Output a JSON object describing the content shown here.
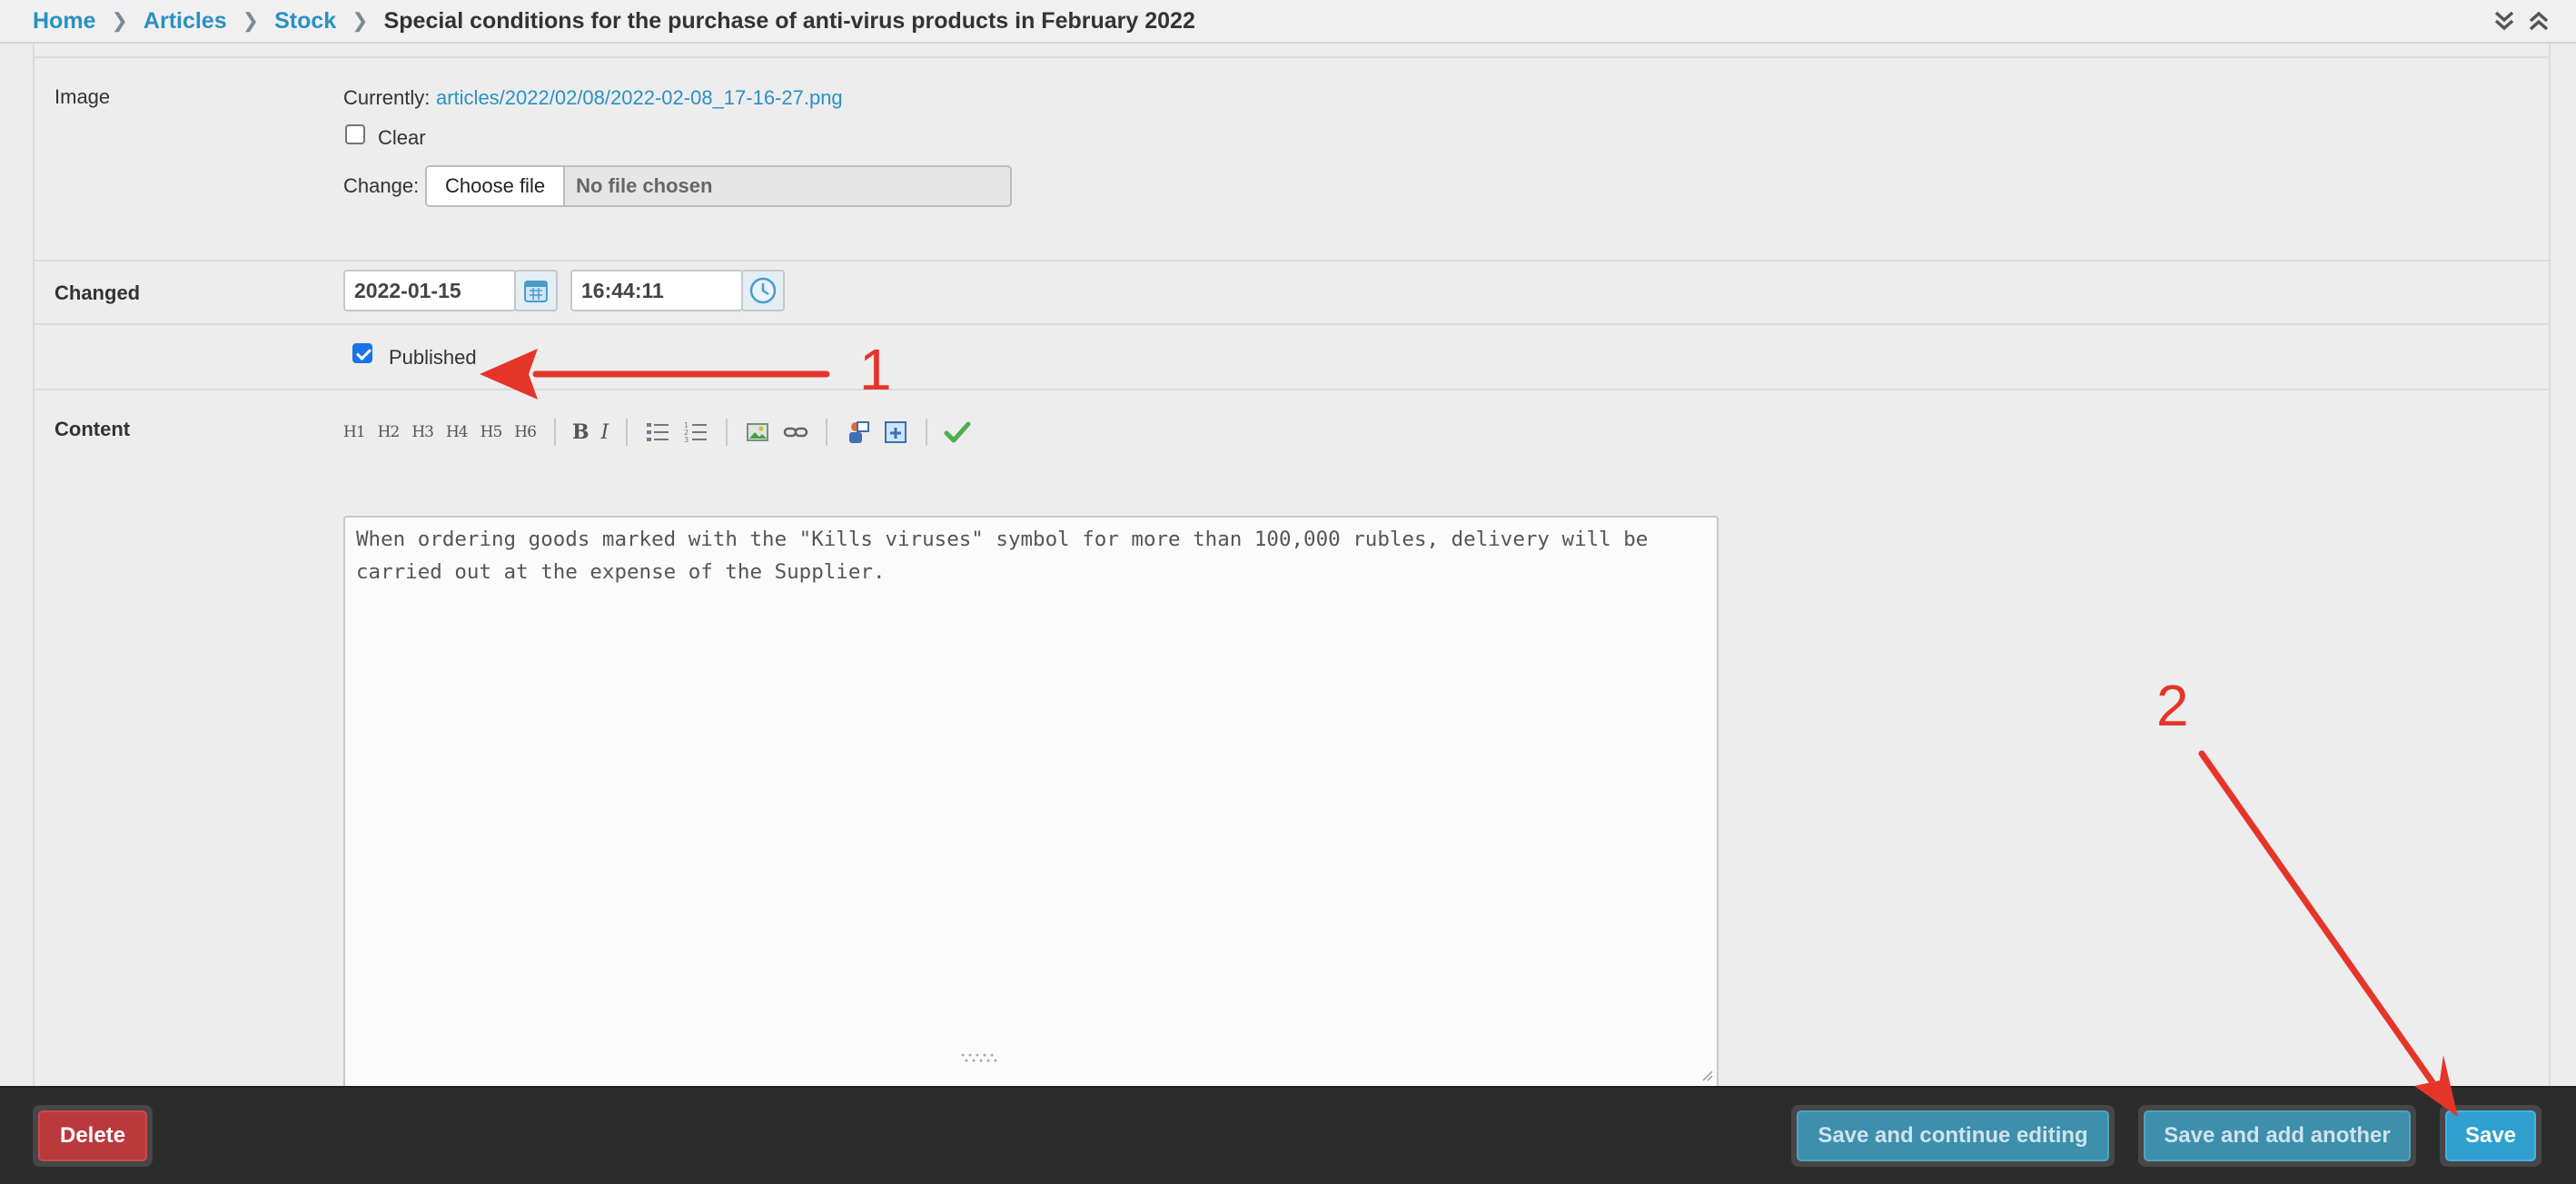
{
  "breadcrumb": {
    "items": [
      "Home",
      "Articles",
      "Stock"
    ],
    "current": "Special conditions for the purchase of anti-virus products in February 2022"
  },
  "image_field": {
    "label": "Image",
    "currently_label": "Currently:",
    "currently_value": "articles/2022/02/08/2022-02-08_17-16-27.png",
    "clear_label": "Clear",
    "clear_checked": false,
    "change_label": "Change:",
    "choose_button": "Choose file",
    "file_status": "No file chosen"
  },
  "changed_field": {
    "label": "Changed",
    "date": "2022-01-15",
    "time": "16:44:11"
  },
  "published_field": {
    "label": "Published",
    "checked": true
  },
  "content_field": {
    "label": "Content",
    "toolbar": {
      "headings": [
        "H1",
        "H2",
        "H3",
        "H4",
        "H5",
        "H6"
      ],
      "bold": "B",
      "italic": "I",
      "icons": [
        "bulleted-list-icon",
        "numbered-list-icon",
        "image-icon",
        "link-icon",
        "user-code-icon",
        "preview-icon",
        "checkmark-icon"
      ]
    },
    "text": "When ordering goods marked with the \"Kills viruses\" symbol for more than 100,000 rubles, delivery will be carried out at the expense of the Supplier."
  },
  "footer": {
    "delete_label": "Delete",
    "save_continue_label": "Save and continue editing",
    "save_add_label": "Save and add another",
    "save_label": "Save"
  },
  "annotations": {
    "marker_1": "1",
    "marker_2": "2",
    "color": "#e5352b"
  },
  "colors": {
    "link": "#2a91c3",
    "footer_bg": "#2c2c2c",
    "delete": "#b9393c",
    "primary": "#2f9fd0"
  }
}
